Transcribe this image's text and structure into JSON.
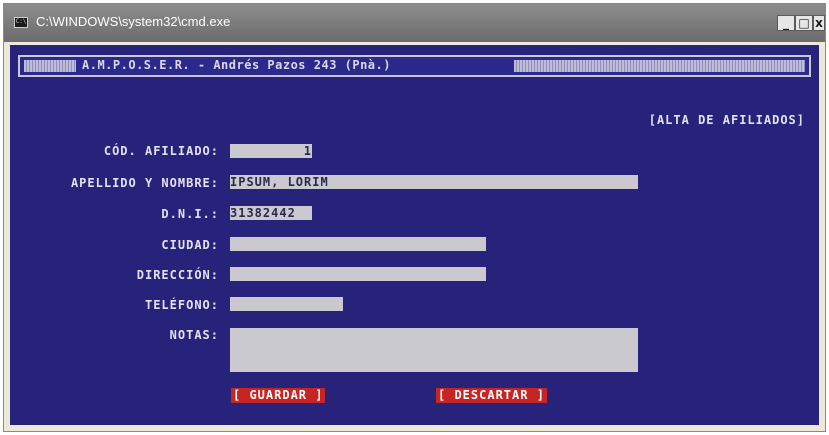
{
  "window": {
    "title": "C:\\WINDOWS\\system32\\cmd.exe",
    "icon": "cmd-icon",
    "controls": {
      "minimize": "_",
      "maximize": "□",
      "close": "x"
    }
  },
  "header": {
    "text": "A.M.P.O.S.E.R. - Andrés Pazos 243 (Pnà.)"
  },
  "screen_title": "[ALTA DE AFILIADOS]",
  "fields": {
    "cod_afiliado": {
      "label": "CÓD. AFILIADO:",
      "value": "1"
    },
    "apellido_nombre": {
      "label": "APELLIDO Y NOMBRE:",
      "value": "IPSUM, LORIM"
    },
    "dni": {
      "label": "D.N.I.:",
      "value": "31382442"
    },
    "ciudad": {
      "label": "CIUDAD:",
      "value": ""
    },
    "direccion": {
      "label": "DIRECCIÓN:",
      "value": ""
    },
    "telefono": {
      "label": "TELÉFONO:",
      "value": ""
    },
    "notas": {
      "label": "NOTAS:",
      "value": ""
    }
  },
  "buttons": {
    "guardar": "[ GUARDAR ]",
    "descartar": "[ DESCARTAR ]"
  },
  "colors": {
    "console_bg": "#28237a",
    "field_bg": "#c9c9cf",
    "button_bg": "#c72424",
    "text": "#e2e2ee"
  }
}
